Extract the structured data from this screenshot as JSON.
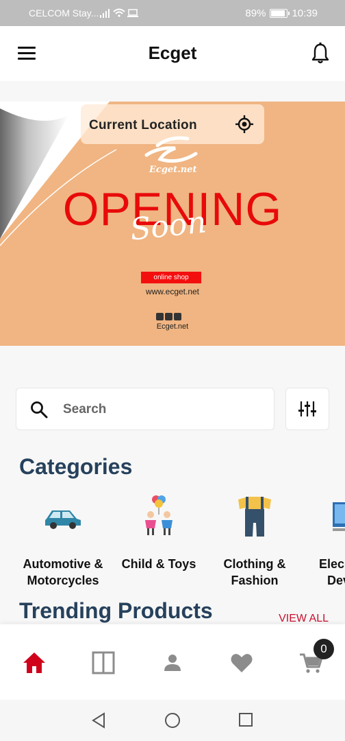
{
  "status_bar": {
    "carrier": "CELCOM Stay...",
    "battery": "89%",
    "time": "10:39"
  },
  "header": {
    "title": "Ecget"
  },
  "banner": {
    "location_label": "Current Location",
    "logo_text": "Ecget.net",
    "headline": "OPENING",
    "script_text": "Soon",
    "badge": "online shop",
    "website": "www.ecget.net",
    "footer_text": "Ecget.net"
  },
  "search": {
    "placeholder": "Search"
  },
  "categories": {
    "title": "Categories",
    "items": [
      {
        "label_line1": "Automotive &",
        "label_line2": "Motorcycles",
        "icon": "car-icon"
      },
      {
        "label_line1": "Child & Toys",
        "label_line2": "",
        "icon": "children-balloons-icon"
      },
      {
        "label_line1": "Clothing &",
        "label_line2": "Fashion",
        "icon": "overalls-icon"
      },
      {
        "label_line1": "Elec",
        "label_line2": "Dev",
        "icon": "monitor-icon"
      }
    ]
  },
  "trending": {
    "title": "Trending Products",
    "view_all": "VIEW ALL"
  },
  "bottom_nav": {
    "items": [
      "home-icon",
      "catalog-icon",
      "profile-icon",
      "wishlist-icon",
      "cart-icon"
    ],
    "cart_count": "0",
    "active_color": "#d0021b"
  },
  "colors": {
    "brand_red": "#d0021b",
    "heading": "#26415c",
    "banner_bg": "#f0b582"
  }
}
